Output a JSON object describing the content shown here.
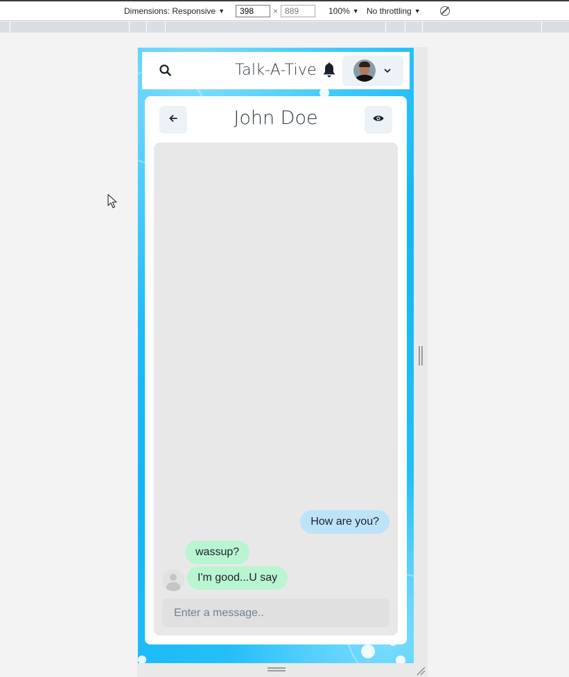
{
  "devtools": {
    "dimensions_label": "Dimensions: Responsive",
    "width_value": "398",
    "height_placeholder": "889",
    "times": "×",
    "zoom": "100%",
    "throttling": "No throttling"
  },
  "app": {
    "title": "Talk-A-Tive",
    "icons": [
      "search-icon",
      "bell-icon",
      "avatar",
      "chevron-down-icon"
    ]
  },
  "chat": {
    "title": "John Doe",
    "back_icon": "arrow-left-icon",
    "view_icon": "eye-icon",
    "messages": [
      {
        "text": "How are you?",
        "sender": "me"
      },
      {
        "text": "wassup?",
        "sender": "them"
      },
      {
        "text": "I'm good...U say",
        "sender": "them"
      }
    ],
    "input_placeholder": "Enter a message.."
  },
  "colors": {
    "sent_bubble": "#bee3f8",
    "received_bubble": "#b9f5d0",
    "background_blue": "#14b5f8"
  }
}
